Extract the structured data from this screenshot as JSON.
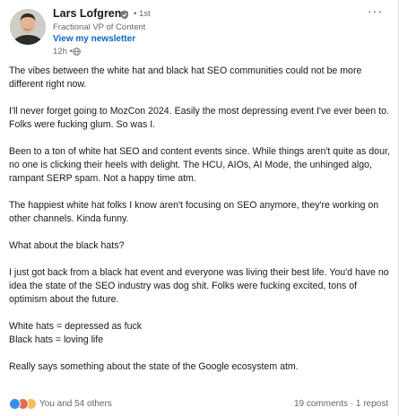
{
  "author": {
    "name": "Lars Lofgren",
    "connection_degree": "1st",
    "headline": "Fractional VP of Content",
    "newsletter_link": "View my newsletter",
    "time_ago": "12h",
    "more_menu": "···"
  },
  "post": {
    "paragraphs": [
      "The vibes between the white hat and black hat SEO communities could not be more different right now.",
      "I'll never forget going to MozCon 2024. Easily the most depressing event I've ever been to. Folks were fucking glum. So was I.",
      "Been to a ton of white hat SEO and content events since. While things aren't quite as dour, no one is clicking their heels with delight. The HCU, AIOs, AI Mode, the unhinged algo, rampant SERP spam. Not a happy time atm.",
      "The happiest white hat folks I know aren't focusing on SEO anymore, they're working on other channels. Kinda funny.",
      "What about the black hats?",
      "I just got back from a black hat event and everyone was living their best life. You'd have no idea the state of the SEO industry was dog shit. Folks were fucking excited, tons of optimism about the future.",
      "White hats = depressed as fuck",
      "Black hats = loving life",
      "Really says something about the state of the Google ecosystem atm."
    ]
  },
  "social": {
    "reactions_text": "You and 54 others",
    "engagement_text": "19 comments · 1 repost",
    "reaction_icons": [
      "like-icon",
      "celebrate-icon",
      "insightful-icon"
    ]
  },
  "colors": {
    "link": "#0a66c2",
    "like": "#378fe9",
    "celebrate": "#df704d",
    "insightful": "#f5bb5c"
  }
}
